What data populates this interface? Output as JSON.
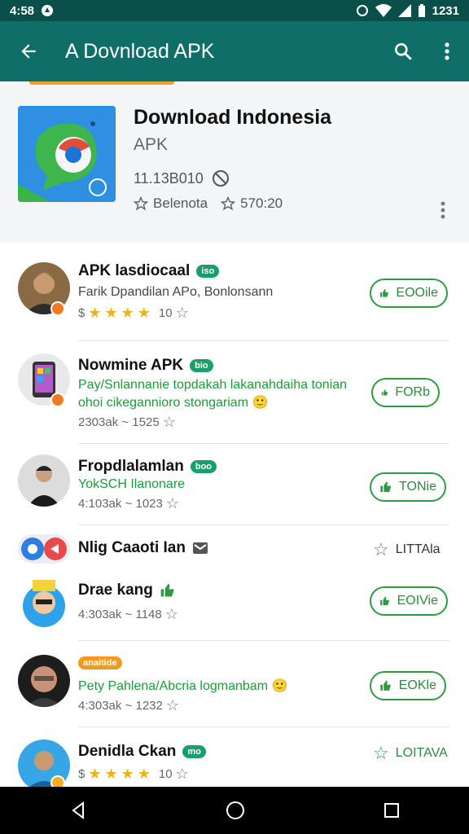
{
  "status_bar": {
    "time": "4:58",
    "battery_text": "1231"
  },
  "app_bar": {
    "title": "A Dovnload APK"
  },
  "hero": {
    "title": "Download Indonesia",
    "subtitle": "APK",
    "version": "11.13B010",
    "meta_left": "Belenota",
    "meta_right": "570:20"
  },
  "rows": [
    {
      "title": "APK lasdiocaal",
      "pill": "iso",
      "line1": "Farik Dpandilan APo, Bonlonsann",
      "line2": "",
      "meta_prefix": "$",
      "rating": 4,
      "meta_suffix": "10",
      "button": "EOOile"
    },
    {
      "title": "Nowmine APK",
      "pill": "bio",
      "line1": "Pay/Snlannanie topdakah lakanahdaiha tonian",
      "line2": "ohoi cikegannioro stongariam",
      "meta": "2303ak ~ 1525",
      "button": "FORb"
    },
    {
      "title": "Fropdlalamlan",
      "pill": "boo",
      "line1": "YokSCH Ilanonare",
      "meta": "4:103ak ~ 1023",
      "button": "TONie"
    },
    {
      "title": "Nlig Caaoti Ian",
      "right_link": "LITTAla"
    },
    {
      "title": "Drae kang",
      "meta": "4:303ak ~ 1148",
      "button": "EOIVie"
    },
    {
      "pill": "anaitide",
      "line1": "Pety Pahlena/Abcria logmanbam",
      "meta": "4:303ak ~ 1232",
      "button": "EOKle"
    },
    {
      "title": "Denidla Ckan",
      "pill": "mo",
      "meta_prefix": "$",
      "rating": 4,
      "meta_suffix": "10",
      "right_link": "LOITAVA"
    }
  ],
  "colors": {
    "appbar": "#0f6e68",
    "status": "#0b4f4a",
    "accent_green": "#2e9b43"
  }
}
